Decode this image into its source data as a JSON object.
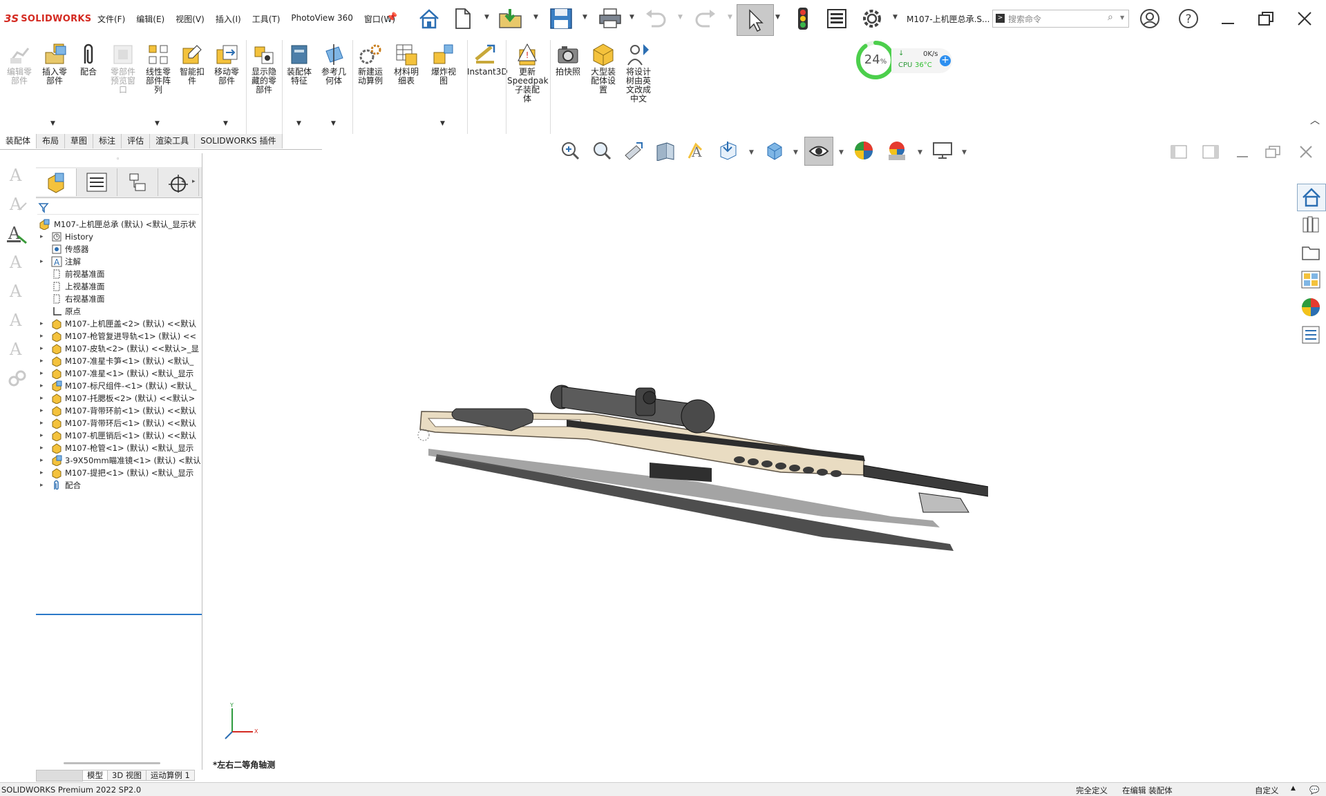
{
  "app": {
    "logo_mark": "3S",
    "logo_text": "SOLIDWORKS",
    "menu": [
      "文件(F)",
      "编辑(E)",
      "视图(V)",
      "插入(I)",
      "工具(T)",
      "PhotoView 360",
      "窗口(W)"
    ],
    "doc_title": "M107-上机匣总承.S...",
    "search_placeholder": "搜索命令",
    "search_prefix_icon": "command-prompt-icon"
  },
  "ribbon": {
    "buttons": [
      {
        "label": "编辑零\n部件",
        "icon": "edit-component-icon",
        "disabled": true
      },
      {
        "label": "插入零\n部件",
        "icon": "insert-component-icon",
        "disabled": false
      },
      {
        "label": "配合",
        "icon": "mate-icon",
        "disabled": false
      },
      {
        "label": "零部件\n预览窗\n口",
        "icon": "component-preview-icon",
        "disabled": true
      },
      {
        "label": "线性零\n部件阵\n列",
        "icon": "linear-pattern-icon",
        "disabled": false
      },
      {
        "label": "智能扣\n件",
        "icon": "smart-fasteners-icon",
        "disabled": false
      },
      {
        "label": "移动零\n部件",
        "icon": "move-component-icon",
        "disabled": false
      },
      {
        "label": "显示隐\n藏的零\n部件",
        "icon": "show-hidden-icon",
        "disabled": false
      },
      {
        "label": "装配体\n特征",
        "icon": "assembly-features-icon",
        "disabled": false
      },
      {
        "label": "参考几\n何体",
        "icon": "reference-geometry-icon",
        "disabled": false
      },
      {
        "label": "新建运\n动算例",
        "icon": "new-motion-study-icon",
        "disabled": false
      },
      {
        "label": "材料明\n细表",
        "icon": "bill-of-materials-icon",
        "disabled": false
      },
      {
        "label": "爆炸视\n图",
        "icon": "exploded-view-icon",
        "disabled": false
      },
      {
        "label": "Instant3D",
        "icon": "instant3d-icon",
        "disabled": false
      },
      {
        "label": "更新\nSpeedpak\n子装配\n体",
        "icon": "speedpak-icon",
        "disabled": false
      },
      {
        "label": "拍快照",
        "icon": "snapshot-icon",
        "disabled": false
      },
      {
        "label": "大型装\n配体设\n置",
        "icon": "large-assembly-icon",
        "disabled": false
      },
      {
        "label": "将设计\n树由英\n文改成\n中文",
        "icon": "translate-tree-icon",
        "disabled": false
      }
    ]
  },
  "cpu": {
    "percent": "24",
    "unit": "%",
    "net": "0K/s",
    "label": "CPU",
    "temp": "36°C",
    "ring_color": "#4ccf4c",
    "temp_color": "#2fbf2f"
  },
  "tabs": [
    "装配体",
    "布局",
    "草图",
    "标注",
    "评估",
    "渲染工具",
    "SOLIDWORKS 插件"
  ],
  "tree": {
    "root": "M107-上机匣总承 (默认) <默认_显示状",
    "items": [
      {
        "label": "History",
        "icon": "history-icon",
        "expand": true
      },
      {
        "label": "传感器",
        "icon": "sensor-icon",
        "expand": false
      },
      {
        "label": "注解",
        "icon": "annotation-icon",
        "expand": true
      },
      {
        "label": "前视基准面",
        "icon": "plane-icon",
        "expand": false
      },
      {
        "label": "上视基准面",
        "icon": "plane-icon",
        "expand": false
      },
      {
        "label": "右视基准面",
        "icon": "plane-icon",
        "expand": false
      },
      {
        "label": "原点",
        "icon": "origin-icon",
        "expand": false
      },
      {
        "label": "M107-上机匣盖<2> (默认) <<默认",
        "icon": "part-icon",
        "expand": true
      },
      {
        "label": "M107-枪管复进导轨<1> (默认) <<",
        "icon": "part-icon",
        "expand": true
      },
      {
        "label": "M107-皮轨<2> (默认) <<默认>_显",
        "icon": "part-icon",
        "expand": true
      },
      {
        "label": "M107-准星卡笋<1> (默认) <默认_",
        "icon": "part-icon",
        "expand": true
      },
      {
        "label": "M107-准星<1> (默认) <默认_显示",
        "icon": "part-icon",
        "expand": true
      },
      {
        "label": "M107-标尺组件-<1> (默认) <默认_",
        "icon": "assembly-icon",
        "expand": true
      },
      {
        "label": "M107-托腮板<2> (默认) <<默认>",
        "icon": "part-icon",
        "expand": true
      },
      {
        "label": "M107-背带环前<1> (默认) <<默认",
        "icon": "part-icon",
        "expand": true
      },
      {
        "label": "M107-背带环后<1> (默认) <<默认",
        "icon": "part-icon",
        "expand": true
      },
      {
        "label": "M107-机匣销后<1> (默认) <<默认",
        "icon": "part-icon",
        "expand": true
      },
      {
        "label": "M107-枪管<1> (默认) <默认_显示",
        "icon": "part-icon",
        "expand": true
      },
      {
        "label": "3-9X50mm瞄准镜<1> (默认) <默认",
        "icon": "assembly-icon",
        "expand": true
      },
      {
        "label": "M107-提把<1> (默认) <默认_显示",
        "icon": "part-icon",
        "expand": true
      },
      {
        "label": "配合",
        "icon": "mates-folder-icon",
        "expand": true
      }
    ]
  },
  "model_tabs": [
    "模型",
    "3D 视图",
    "运动算例 1"
  ],
  "viewport": {
    "view_name": "*左右二等角轴测",
    "axis_x": "X",
    "axis_y": "Y"
  },
  "status": {
    "product": "SOLIDWORKS Premium 2022 SP2.0",
    "defined": "完全定义",
    "editing": "在编辑 装配体",
    "custom": "自定义"
  }
}
